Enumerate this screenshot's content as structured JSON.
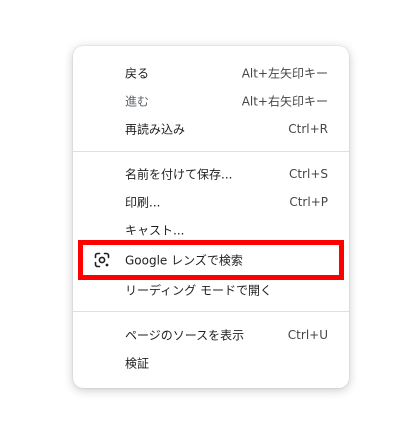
{
  "context_menu": {
    "items": [
      {
        "label": "戻る",
        "shortcut": "Alt+左矢印キー"
      },
      {
        "label": "進む",
        "shortcut": "Alt+右矢印キー"
      },
      {
        "label": "再読み込み",
        "shortcut": "Ctrl+R"
      },
      {
        "label": "名前を付けて保存...",
        "shortcut": "Ctrl+S"
      },
      {
        "label": "印刷...",
        "shortcut": "Ctrl+P"
      },
      {
        "label": "キャスト..."
      },
      {
        "label": "Google レンズで検索",
        "icon": "google-lens-icon"
      },
      {
        "label": "リーディング モードで開く"
      },
      {
        "label": "ページのソースを表示",
        "shortcut": "Ctrl+U"
      },
      {
        "label": "検証"
      }
    ]
  },
  "colors": {
    "highlight_border": "#ff0000",
    "menu_background": "#ffffff",
    "text": "#1f1f1f",
    "separator": "#dcdfe3"
  }
}
